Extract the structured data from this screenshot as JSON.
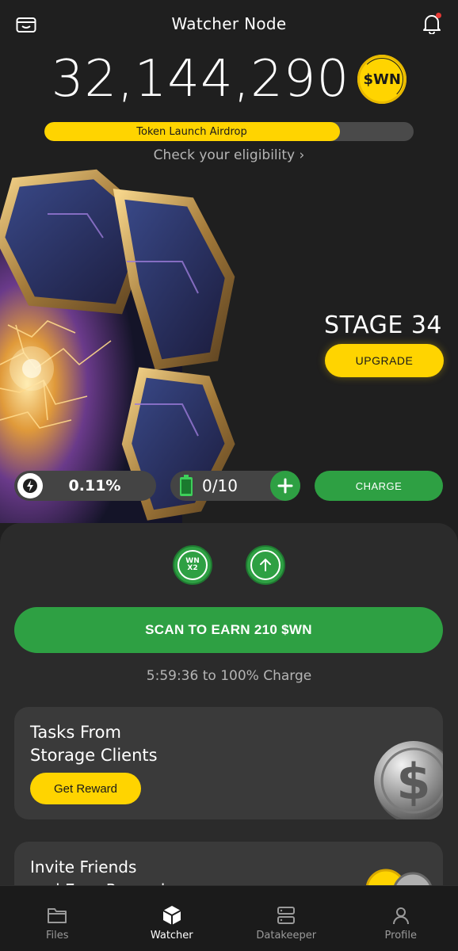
{
  "header": {
    "title": "Watcher Node",
    "wallet_icon": "wallet-icon",
    "bell_icon": "bell-icon",
    "notification_dot_color": "#e53935"
  },
  "balance": {
    "value": "32,144,290",
    "coin_label": "$WN"
  },
  "airdrop": {
    "label": "Token Launch Airdrop",
    "progress_fraction": 0.8,
    "check_link": "Check your eligibility",
    "chevron": "›"
  },
  "stage": {
    "label": "STAGE 34",
    "upgrade_label": "UPGRADE"
  },
  "stats": {
    "energy_value": "0.11%",
    "battery_value": "0/10",
    "charge_label": "CHARGE"
  },
  "boosts": {
    "x2_line1": "WN",
    "x2_line2": "X2"
  },
  "scan": {
    "button_label": "SCAN TO EARN 210 $WN",
    "charge_time": "5:59:36 to 100% Charge"
  },
  "tasks_card": {
    "title_line1": "Tasks From",
    "title_line2": "Storage Clients",
    "button_label": "Get Reward"
  },
  "invite_card": {
    "title_line1": "Invite Friends",
    "title_line2": "and Earn Rewards"
  },
  "nav": {
    "items": [
      {
        "label": "Files",
        "icon": "folder-icon"
      },
      {
        "label": "Watcher",
        "icon": "cube-icon"
      },
      {
        "label": "Datakeeper",
        "icon": "server-icon"
      },
      {
        "label": "Profile",
        "icon": "user-icon"
      }
    ],
    "active_index": 1
  },
  "colors": {
    "background": "#1f1f1f",
    "panel": "#2b2b2b",
    "card": "#3a3a3a",
    "yellow": "#ffd400",
    "green": "#2ea043"
  }
}
